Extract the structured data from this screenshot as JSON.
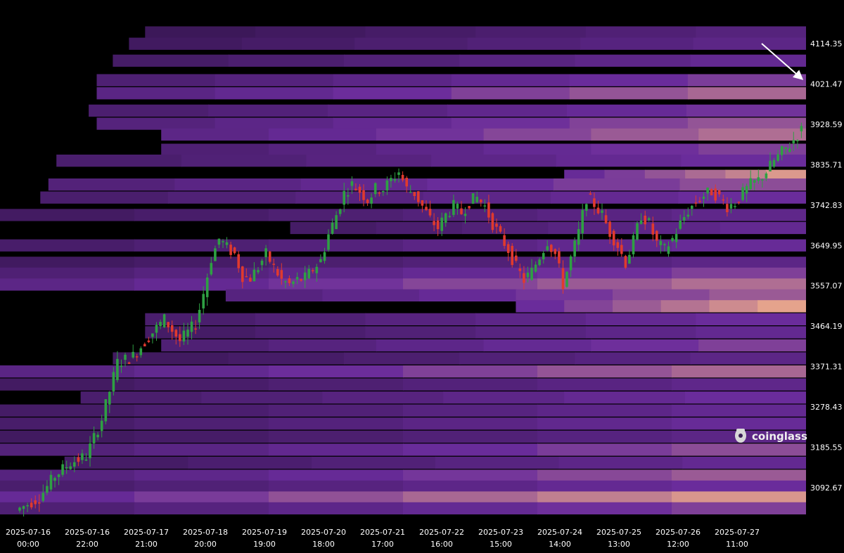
{
  "brand": {
    "name": "coinglass",
    "icon": "coinglass-logo-icon"
  },
  "colors": {
    "background": "#000000",
    "candle_up": "#2ea043",
    "candle_down": "#e03a2e",
    "heat_low": "#14061f",
    "heat_mid": "#6a2c9b",
    "heat_high": "#f3b08a",
    "axis_text": "#ffffff",
    "annotation_arrow": "#ffffff"
  },
  "chart_data": {
    "type": "heatmap",
    "title": "",
    "xlabel": "",
    "ylabel": "",
    "ylim": [
      3030,
      4170
    ],
    "y_ticks": [
      "4114.35",
      "4021.47",
      "3928.59",
      "3835.71",
      "3742.83",
      "3649.95",
      "3557.07",
      "3464.19",
      "3371.31",
      "3278.43",
      "3185.55",
      "3092.67"
    ],
    "x_ticks": [
      [
        "2025-07-16",
        "00:00"
      ],
      [
        "2025-07-16",
        "22:00"
      ],
      [
        "2025-07-17",
        "21:00"
      ],
      [
        "2025-07-18",
        "20:00"
      ],
      [
        "2025-07-19",
        "19:00"
      ],
      [
        "2025-07-20",
        "18:00"
      ],
      [
        "2025-07-21",
        "17:00"
      ],
      [
        "2025-07-22",
        "16:00"
      ],
      [
        "2025-07-23",
        "15:00"
      ],
      [
        "2025-07-24",
        "14:00"
      ],
      [
        "2025-07-25",
        "13:00"
      ],
      [
        "2025-07-26",
        "12:00"
      ],
      [
        "2025-07-27",
        "11:00"
      ]
    ],
    "grid": false,
    "legend": "none",
    "price_path": [
      [
        0,
        3040
      ],
      [
        6,
        3070
      ],
      [
        10,
        3120
      ],
      [
        14,
        3150
      ],
      [
        18,
        3165
      ],
      [
        22,
        3250
      ],
      [
        26,
        3380
      ],
      [
        30,
        3395
      ],
      [
        34,
        3440
      ],
      [
        38,
        3480
      ],
      [
        42,
        3430
      ],
      [
        46,
        3470
      ],
      [
        48,
        3540
      ],
      [
        50,
        3620
      ],
      [
        52,
        3665
      ],
      [
        54,
        3645
      ],
      [
        56,
        3630
      ],
      [
        58,
        3580
      ],
      [
        60,
        3575
      ],
      [
        62,
        3600
      ],
      [
        64,
        3630
      ],
      [
        66,
        3600
      ],
      [
        68,
        3570
      ],
      [
        70,
        3560
      ],
      [
        72,
        3570
      ],
      [
        74,
        3575
      ],
      [
        76,
        3595
      ],
      [
        78,
        3615
      ],
      [
        80,
        3675
      ],
      [
        82,
        3720
      ],
      [
        84,
        3770
      ],
      [
        86,
        3790
      ],
      [
        88,
        3775
      ],
      [
        90,
        3755
      ],
      [
        92,
        3780
      ],
      [
        94,
        3780
      ],
      [
        96,
        3800
      ],
      [
        98,
        3820
      ],
      [
        100,
        3780
      ],
      [
        102,
        3770
      ],
      [
        104,
        3740
      ],
      [
        106,
        3710
      ],
      [
        108,
        3690
      ],
      [
        110,
        3720
      ],
      [
        112,
        3740
      ],
      [
        114,
        3725
      ],
      [
        116,
        3750
      ],
      [
        118,
        3760
      ],
      [
        120,
        3740
      ],
      [
        122,
        3700
      ],
      [
        124,
        3670
      ],
      [
        126,
        3640
      ],
      [
        128,
        3600
      ],
      [
        130,
        3570
      ],
      [
        132,
        3590
      ],
      [
        134,
        3625
      ],
      [
        136,
        3660
      ],
      [
        138,
        3630
      ],
      [
        140,
        3560
      ],
      [
        142,
        3620
      ],
      [
        144,
        3680
      ],
      [
        146,
        3760
      ],
      [
        148,
        3745
      ],
      [
        150,
        3720
      ],
      [
        152,
        3680
      ],
      [
        154,
        3650
      ],
      [
        156,
        3610
      ],
      [
        158,
        3660
      ],
      [
        160,
        3720
      ],
      [
        162,
        3700
      ],
      [
        164,
        3655
      ],
      [
        166,
        3640
      ],
      [
        168,
        3665
      ],
      [
        170,
        3700
      ],
      [
        172,
        3730
      ],
      [
        174,
        3750
      ],
      [
        176,
        3765
      ],
      [
        178,
        3775
      ],
      [
        180,
        3760
      ],
      [
        182,
        3740
      ],
      [
        184,
        3748
      ],
      [
        186,
        3770
      ],
      [
        188,
        3790
      ],
      [
        190,
        3800
      ],
      [
        192,
        3820
      ],
      [
        194,
        3845
      ],
      [
        196,
        3865
      ],
      [
        198,
        3880
      ],
      [
        200,
        3905
      ],
      [
        201,
        3915
      ]
    ],
    "price_x_range": [
      0,
      201
    ],
    "liquidity_levels": [
      {
        "price": 4140,
        "intensity": 0.45,
        "start": 0.18
      },
      {
        "price": 4114,
        "intensity": 0.5,
        "start": 0.16
      },
      {
        "price": 4075,
        "intensity": 0.55,
        "start": 0.14
      },
      {
        "price": 4030,
        "intensity": 0.65,
        "start": 0.12
      },
      {
        "price": 4000,
        "intensity": 0.78,
        "start": 0.12
      },
      {
        "price": 3960,
        "intensity": 0.62,
        "start": 0.11
      },
      {
        "price": 3930,
        "intensity": 0.72,
        "start": 0.12
      },
      {
        "price": 3905,
        "intensity": 0.8,
        "start": 0.2
      },
      {
        "price": 3870,
        "intensity": 0.66,
        "start": 0.2
      },
      {
        "price": 3845,
        "intensity": 0.6,
        "start": 0.07
      },
      {
        "price": 3810,
        "intensity": 0.93,
        "start": 0.7
      },
      {
        "price": 3790,
        "intensity": 0.7,
        "start": 0.06
      },
      {
        "price": 3760,
        "intensity": 0.6,
        "start": 0.05
      },
      {
        "price": 3720,
        "intensity": 0.52,
        "start": 0.0
      },
      {
        "price": 3690,
        "intensity": 0.55,
        "start": 0.36
      },
      {
        "price": 3650,
        "intensity": 0.58,
        "start": 0.0
      },
      {
        "price": 3610,
        "intensity": 0.5,
        "start": 0.0
      },
      {
        "price": 3585,
        "intensity": 0.66,
        "start": 0.0
      },
      {
        "price": 3560,
        "intensity": 0.8,
        "start": 0.0
      },
      {
        "price": 3535,
        "intensity": 0.74,
        "start": 0.28
      },
      {
        "price": 3510,
        "intensity": 0.96,
        "start": 0.64
      },
      {
        "price": 3480,
        "intensity": 0.6,
        "start": 0.18
      },
      {
        "price": 3450,
        "intensity": 0.55,
        "start": 0.18
      },
      {
        "price": 3420,
        "intensity": 0.66,
        "start": 0.2
      },
      {
        "price": 3390,
        "intensity": 0.5,
        "start": 0.14
      },
      {
        "price": 3360,
        "intensity": 0.78,
        "start": 0.0
      },
      {
        "price": 3330,
        "intensity": 0.52,
        "start": 0.0
      },
      {
        "price": 3300,
        "intensity": 0.6,
        "start": 0.1
      },
      {
        "price": 3270,
        "intensity": 0.55,
        "start": 0.0
      },
      {
        "price": 3240,
        "intensity": 0.58,
        "start": 0.0
      },
      {
        "price": 3210,
        "intensity": 0.5,
        "start": 0.0
      },
      {
        "price": 3180,
        "intensity": 0.7,
        "start": 0.0
      },
      {
        "price": 3150,
        "intensity": 0.55,
        "start": 0.08
      },
      {
        "price": 3120,
        "intensity": 0.74,
        "start": 0.0
      },
      {
        "price": 3095,
        "intensity": 0.6,
        "start": 0.0
      },
      {
        "price": 3070,
        "intensity": 0.92,
        "start": 0.0
      },
      {
        "price": 3045,
        "intensity": 0.66,
        "start": 0.0
      }
    ]
  }
}
